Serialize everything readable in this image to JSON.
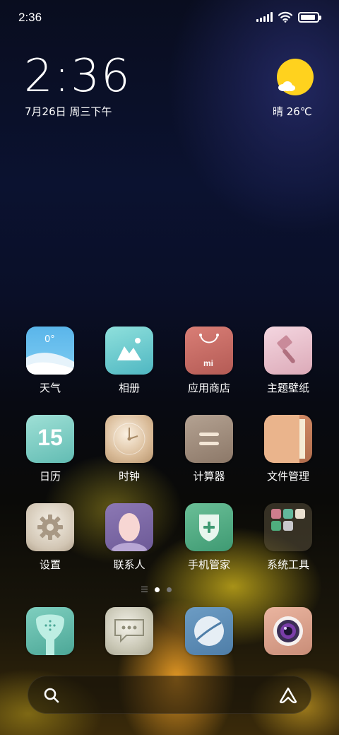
{
  "status": {
    "time": "2:36",
    "battery_level": 0.9
  },
  "widget": {
    "clock": "2:36",
    "date": "7月26日 周三下午",
    "weather": "晴 26℃"
  },
  "apps": [
    {
      "label": "天气",
      "icon": "weather-icon",
      "temp": "0°"
    },
    {
      "label": "相册",
      "icon": "gallery-icon"
    },
    {
      "label": "应用商店",
      "icon": "app-store-icon",
      "brand": "mi"
    },
    {
      "label": "主题壁纸",
      "icon": "themes-icon"
    },
    {
      "label": "日历",
      "icon": "calendar-icon",
      "day": "15"
    },
    {
      "label": "时钟",
      "icon": "clock-icon"
    },
    {
      "label": "计算器",
      "icon": "calculator-icon"
    },
    {
      "label": "文件管理",
      "icon": "file-manager-icon"
    },
    {
      "label": "设置",
      "icon": "settings-icon"
    },
    {
      "label": "联系人",
      "icon": "contacts-icon"
    },
    {
      "label": "手机管家",
      "icon": "security-icon"
    },
    {
      "label": "系统工具",
      "icon": "system-tools-folder-icon"
    }
  ],
  "dock": [
    {
      "icon": "phone-icon"
    },
    {
      "icon": "messages-icon"
    },
    {
      "icon": "browser-icon"
    },
    {
      "icon": "camera-icon"
    }
  ],
  "pager": {
    "pages": 2,
    "current": 1
  },
  "colors": {
    "sun": "#ffd21e",
    "accent": "#ffffff"
  }
}
